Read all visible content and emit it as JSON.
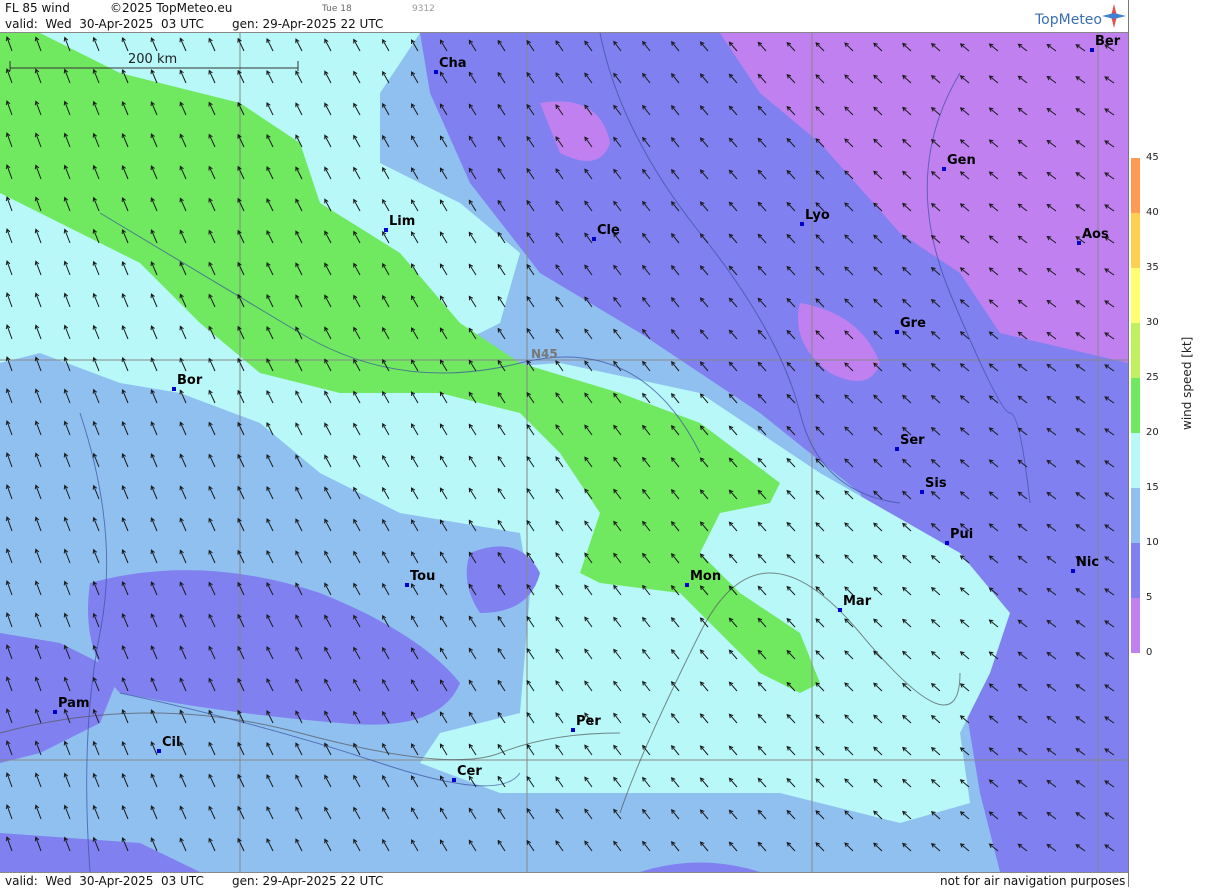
{
  "header": {
    "product": "FL 85 wind",
    "copyright": "©2025 TopMeteo.eu",
    "valid": "valid:  Wed  30-Apr-2025  03 UTC",
    "gen": "gen: 29-Apr-2025 22 UTC",
    "small_a": "Tue 18",
    "small_b": "9312",
    "logo": "TopMeteo"
  },
  "footer": {
    "valid": "valid:  Wed  30-Apr-2025  03 UTC",
    "gen": "gen: 29-Apr-2025 22 UTC",
    "disclaimer": "not for air navigation purposes"
  },
  "map": {
    "scale_label": "200 km",
    "grid_label": "N45",
    "cities": [
      "Cha",
      "Lim",
      "Cle",
      "Lyo",
      "Gen",
      "Ber",
      "Aos",
      "Gre",
      "Bor",
      "Ser",
      "Sis",
      "Pui",
      "Nic",
      "Tou",
      "Mon",
      "Mar",
      "Pam",
      "Cil",
      "Per",
      "Cer"
    ]
  },
  "legend": {
    "unit": "wind speed [kt]",
    "ticks": [
      "45",
      "40",
      "35",
      "30",
      "25",
      "20",
      "15",
      "10",
      "5",
      "0"
    ],
    "colors": [
      "#f07a5a",
      "#ff9a55",
      "#ffd050",
      "#ffff70",
      "#c0f060",
      "#70e860",
      "#b8f8f8",
      "#90c0f0",
      "#8080f0",
      "#c080f0"
    ]
  }
}
